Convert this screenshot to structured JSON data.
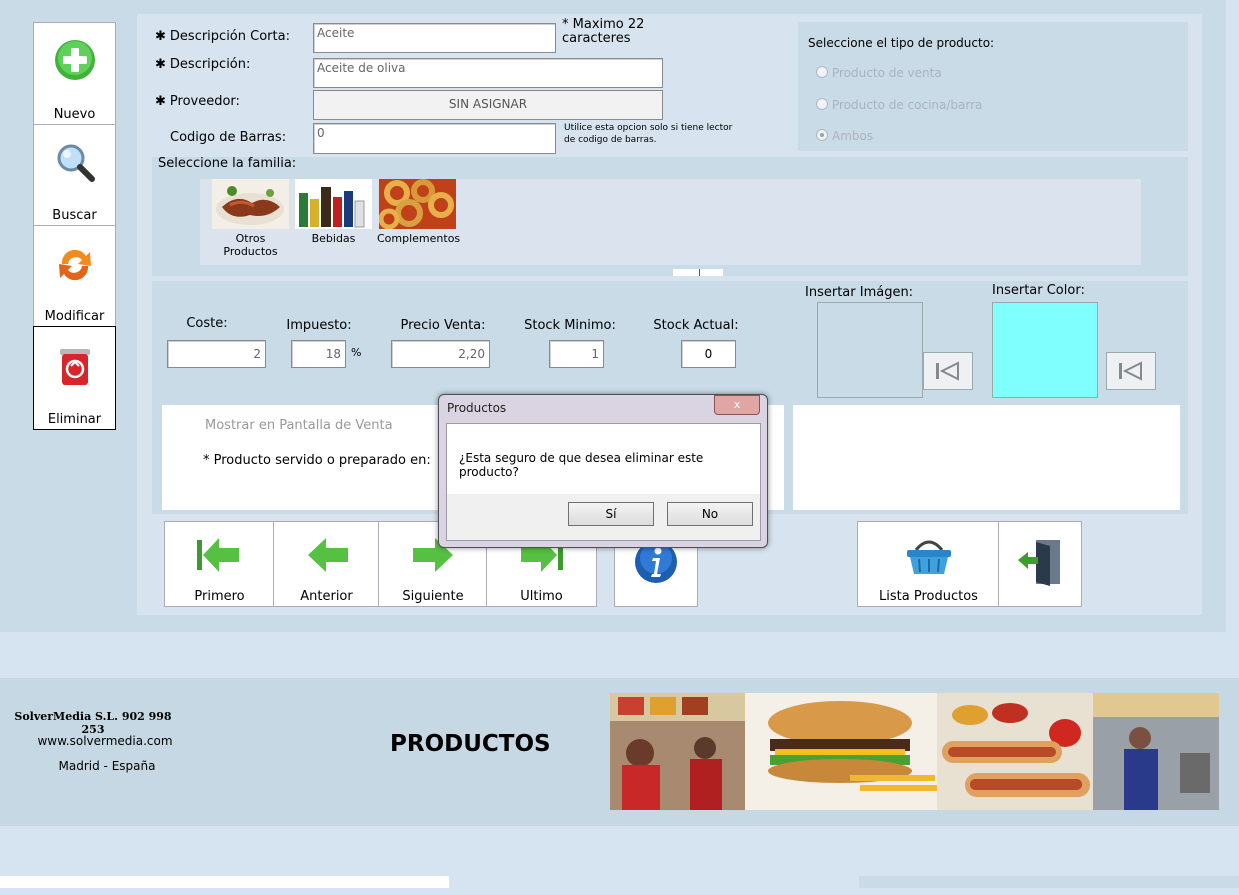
{
  "toolbar": {
    "nuevo": "Nuevo",
    "buscar": "Buscar",
    "modificar": "Modificar",
    "eliminar": "Eliminar"
  },
  "form": {
    "desc_corta_label": "Descripción Corta:",
    "desc_corta_value": "Aceite",
    "max_note": "* Maximo 22 caracteres",
    "descripcion_label": "Descripción:",
    "descripcion_value": "Aceite de oliva",
    "proveedor_label": "Proveedor:",
    "proveedor_value": "SIN ASIGNAR",
    "codigo_label": "Codigo de Barras:",
    "codigo_value": "0",
    "codigo_note": "Utilice esta opcion solo si tiene lector de codigo de barras."
  },
  "tipo": {
    "title": "Seleccione el tipo de producto:",
    "options": [
      "Producto de venta",
      "Producto de cocina/barra",
      "Ambos"
    ],
    "selected": "Ambos"
  },
  "familia": {
    "title": "Seleccione la familia:",
    "items": [
      "Otros Productos",
      "Bebidas",
      "Complementos"
    ]
  },
  "precios": {
    "coste_label": "Coste:",
    "coste_value": "2",
    "impuesto_label": "Impuesto:",
    "impuesto_value": "18",
    "percent": "%",
    "precio_label": "Precio Venta:",
    "precio_value": "2,20",
    "stock_min_label": "Stock Minimo:",
    "stock_min_value": "1",
    "stock_act_label": "Stock Actual:",
    "stock_act_value": "0"
  },
  "media": {
    "imagen_label": "Insertar Imágen:",
    "color_label": "Insertar Color:",
    "color_value": "#80ffff"
  },
  "venta": {
    "mostrar": "Mostrar en Pantalla de Venta",
    "servido": "* Producto servido o preparado en:"
  },
  "nav": {
    "primero": "Primero",
    "anterior": "Anterior",
    "siguiente": "Siguiente",
    "ultimo": "Ultimo",
    "lista": "Lista Productos"
  },
  "dialog": {
    "title": "Productos",
    "message": "¿Esta seguro de que desea eliminar este producto?",
    "yes": "Sí",
    "no": "No",
    "close": "x"
  },
  "footer": {
    "company": "SolverMedia S.L. 902 998 253",
    "web": "www.solvermedia.com",
    "location": "Madrid - España",
    "title": "PRODUCTOS"
  }
}
